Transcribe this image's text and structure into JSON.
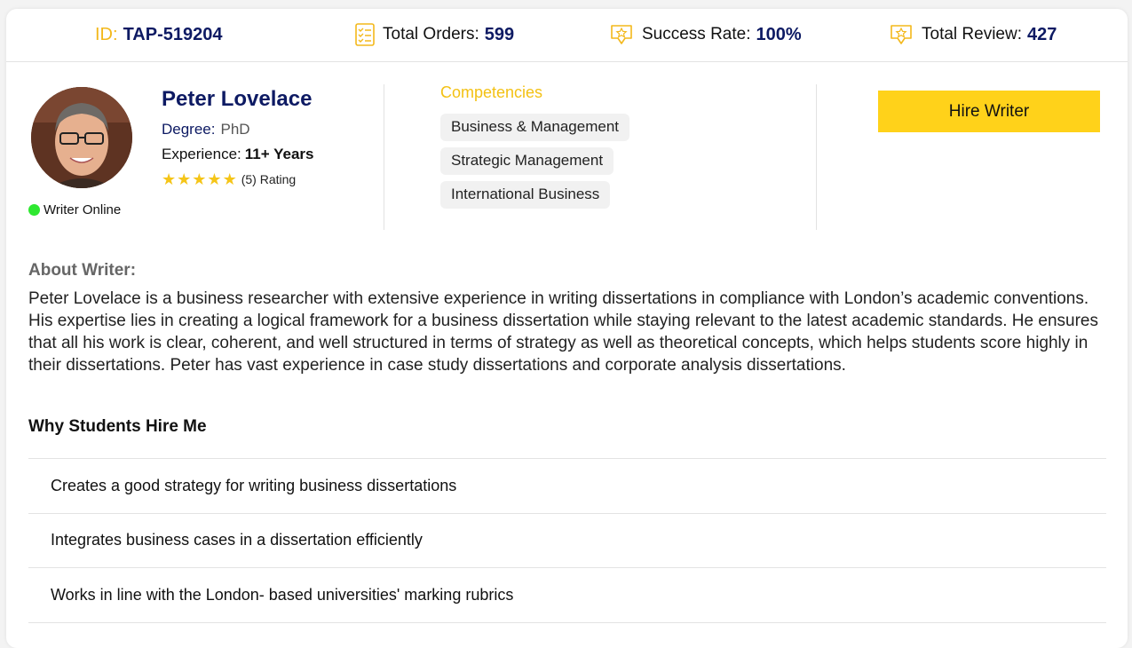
{
  "stats": {
    "id_label": "ID:",
    "id_value": "TAP-519204",
    "orders_label": "Total Orders:",
    "orders_value": "599",
    "success_label": "Success Rate:",
    "success_value": "100%",
    "review_label": "Total Review:",
    "review_value": "427"
  },
  "writer": {
    "name": "Peter Lovelace",
    "degree_label": "Degree:",
    "degree_value": "PhD",
    "experience_label": "Experience:",
    "experience_value": "11+ Years",
    "rating_text": "(5) Rating",
    "rating_stars": 5,
    "online_text": "Writer Online"
  },
  "competencies": {
    "title": "Competencies",
    "items": [
      "Business & Management",
      "Strategic Management",
      "International Business"
    ]
  },
  "hire_button": "Hire Writer",
  "about": {
    "heading": "About Writer:",
    "text": "Peter Lovelace is a business researcher with extensive experience in writing dissertations in compliance with London’s academic conventions. His expertise lies in creating a logical framework for a business dissertation while staying relevant to the latest academic standards. He ensures that all his work is clear, coherent, and well structured in terms of strategy as well as theoretical concepts, which helps students score highly in their dissertations. Peter has vast experience in case study dissertations and corporate analysis dissertations."
  },
  "why": {
    "heading": "Why Students Hire Me",
    "items": [
      "Creates a good strategy for writing business dissertations",
      "Integrates business cases in a dissertation efficiently",
      "Works in line with the London- based universities' marking rubrics"
    ]
  },
  "colors": {
    "navy": "#0d1a63",
    "accent_yellow": "#ffd21a",
    "online_green": "#2ee830"
  },
  "icons": {
    "orders": "checklist-icon",
    "success": "badge-star-icon",
    "review": "badge-star-icon"
  }
}
